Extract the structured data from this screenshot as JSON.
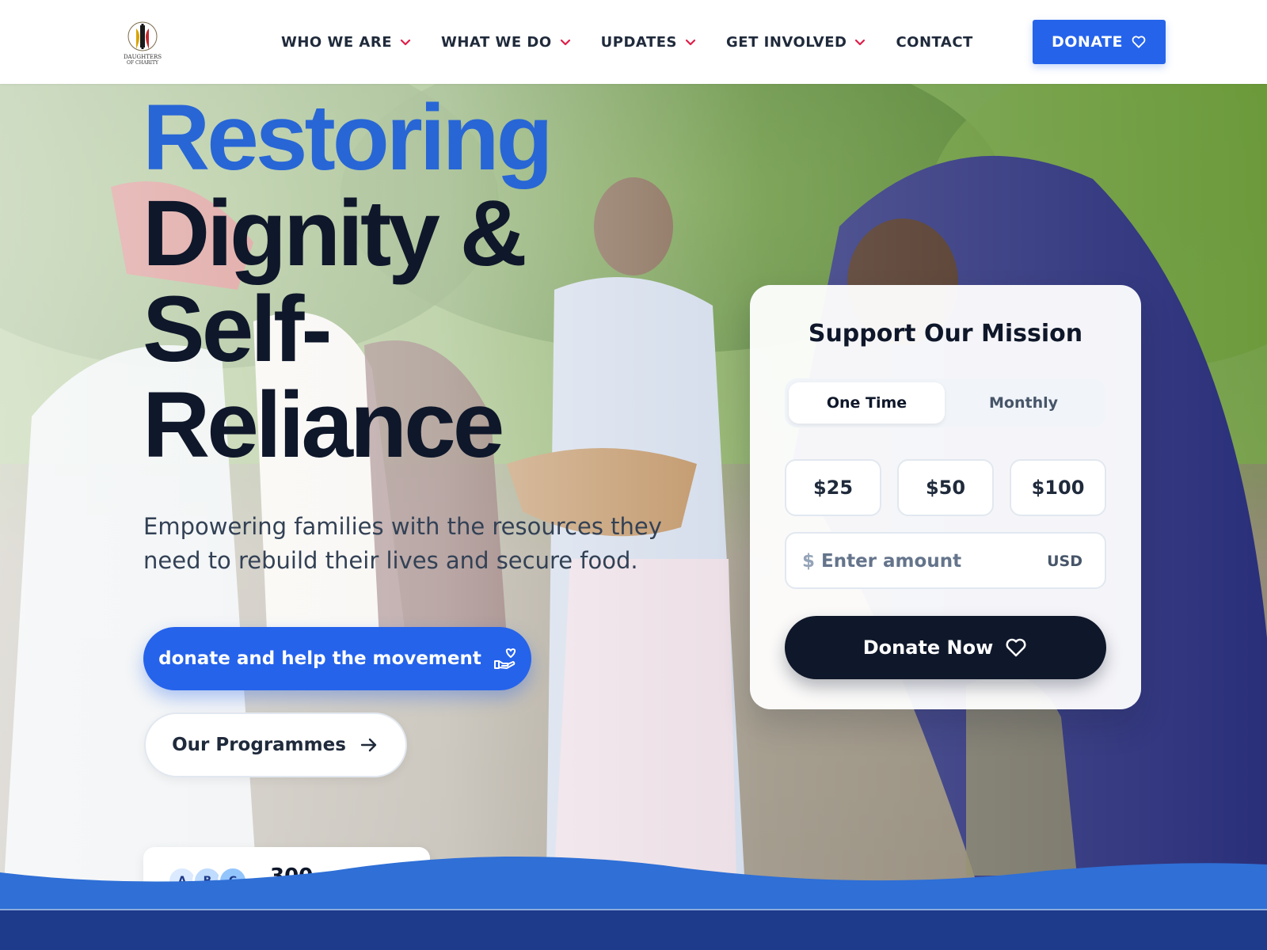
{
  "header": {
    "logo_alt": "Daughters of Charity",
    "nav": [
      {
        "label": "WHO WE ARE",
        "has_dropdown": true
      },
      {
        "label": "WHAT WE DO",
        "has_dropdown": true
      },
      {
        "label": "UPDATES",
        "has_dropdown": true
      },
      {
        "label": "GET INVOLVED",
        "has_dropdown": true
      },
      {
        "label": "CONTACT",
        "has_dropdown": false
      }
    ],
    "donate_label": "DONATE",
    "donate_icon": "heart-icon"
  },
  "hero": {
    "headline_accent": "Restoring",
    "headline_line2": "Dignity &",
    "headline_line3": "Self-",
    "headline_line4": "Reliance",
    "subtitle": "Empowering families with the resources they need to rebuild their lives and secure food.",
    "cta_primary": "donate and help the movement",
    "cta_primary_icon": "hand-heart-icon",
    "cta_secondary": "Our Programmes",
    "cta_secondary_icon": "arrow-right-icon",
    "supporters": {
      "avatars": [
        "A",
        "B",
        "C"
      ],
      "count": "300"
    }
  },
  "donation_card": {
    "title": "Support Our Mission",
    "frequency_options": [
      "One Time",
      "Monthly"
    ],
    "frequency_selected": "One Time",
    "amounts": [
      "$25",
      "$50",
      "$100"
    ],
    "currency_symbol": "$",
    "custom_placeholder": "Enter amount",
    "currency_code": "USD",
    "submit_label": "Donate Now",
    "submit_icon": "heart-icon"
  },
  "colors": {
    "primary": "#2563eb",
    "accent_text": "#2866d6",
    "dark": "#0f172a",
    "wave": "#2f6fd6",
    "footer_band": "#1e3a8a"
  }
}
